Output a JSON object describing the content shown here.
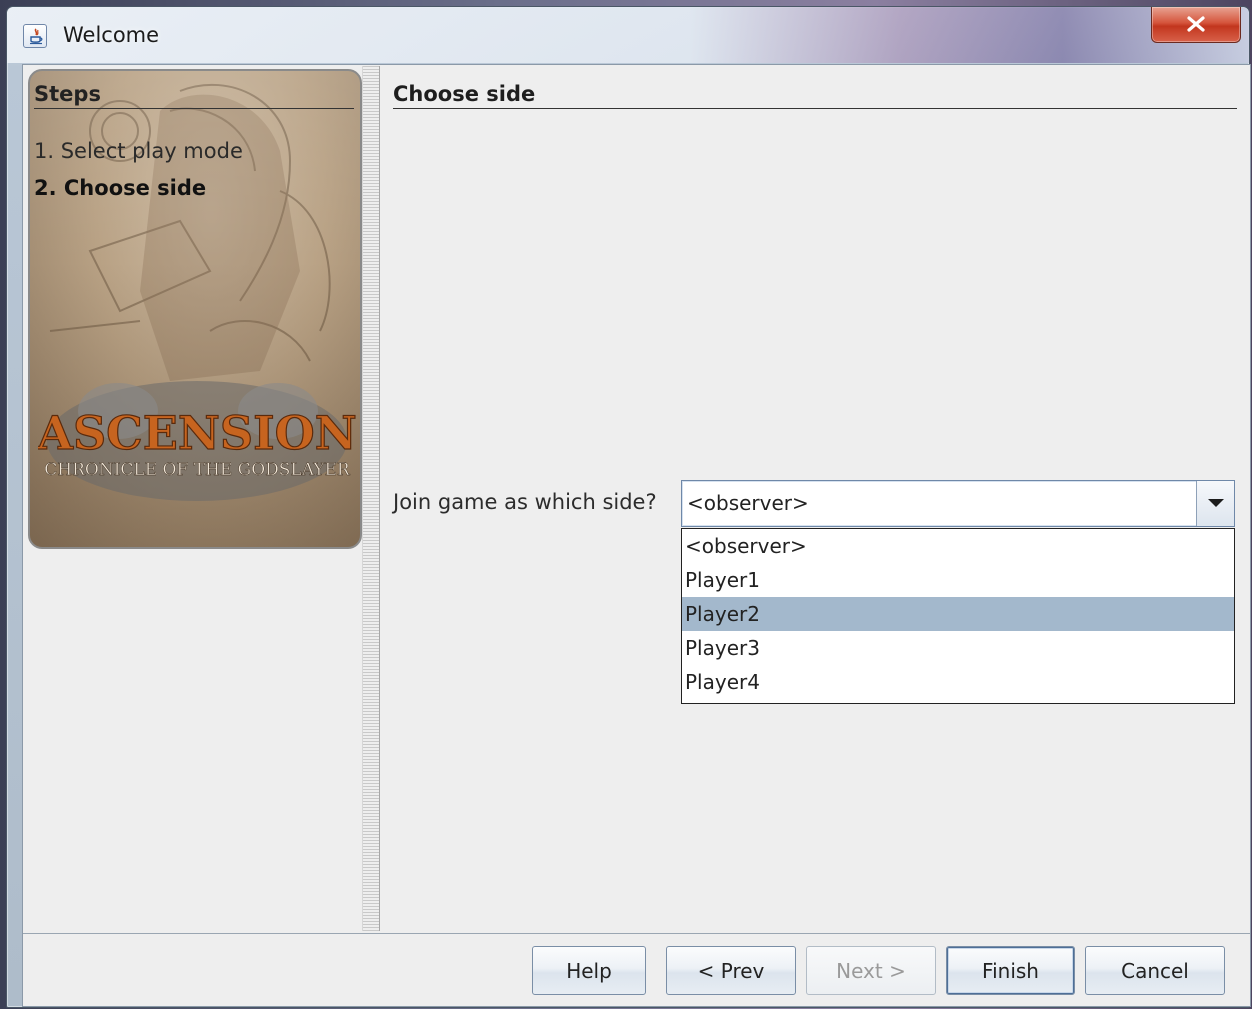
{
  "window": {
    "title": "Welcome"
  },
  "steps": {
    "title": "Steps",
    "items": [
      {
        "label": "1. Select play mode",
        "current": false
      },
      {
        "label": "2. Choose side",
        "current": true
      }
    ]
  },
  "splash": {
    "logo_title": "ASCENSION",
    "logo_subtitle": "CHRONICLE OF THE GODSLAYER"
  },
  "main": {
    "section_title": "Choose side",
    "join_label": "Join game as which side?",
    "side_combo": {
      "selected": "<observer>",
      "options": [
        "<observer>",
        "Player1",
        "Player2",
        "Player3",
        "Player4"
      ],
      "highlighted_index": 2
    }
  },
  "buttons": {
    "help": "Help",
    "prev": "< Prev",
    "next": "Next >",
    "finish": "Finish",
    "cancel": "Cancel"
  },
  "colors": {
    "highlight": "#a3b8cc",
    "close_red": "#c2361e"
  }
}
